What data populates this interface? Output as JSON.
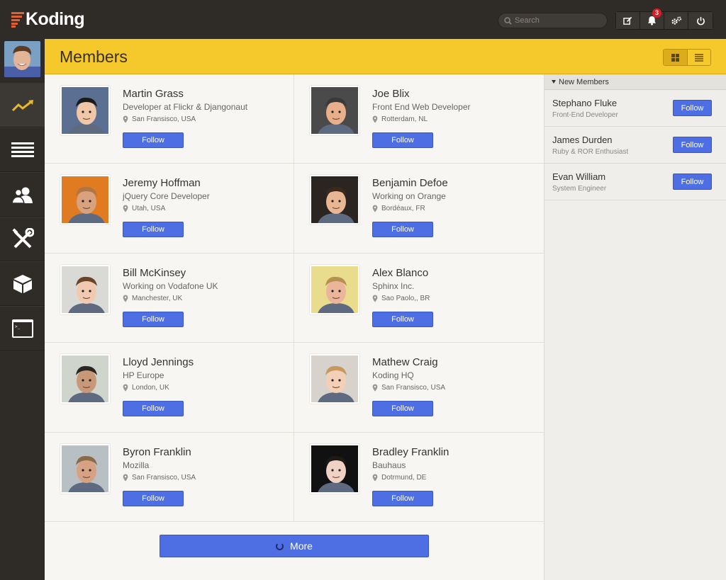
{
  "app": {
    "name": "Koding"
  },
  "search": {
    "placeholder": "Search"
  },
  "notifications": {
    "count": "3"
  },
  "header": {
    "title": "Members"
  },
  "members": [
    {
      "name": "Martin Grass",
      "title": "Developer at Flickr & Djangonaut",
      "location": "San Fransisco, USA",
      "follow": "Follow"
    },
    {
      "name": "Joe Blix",
      "title": "Front End Web Developer",
      "location": "Rotterdam, NL",
      "follow": "Follow"
    },
    {
      "name": "Jeremy Hoffman",
      "title": "jQuery Core Developer",
      "location": "Utah, USA",
      "follow": "Follow"
    },
    {
      "name": "Benjamin Defoe",
      "title": "Working on Orange",
      "location": "Bordéaux, FR",
      "follow": "Follow"
    },
    {
      "name": "Bill McKinsey",
      "title": "Working on Vodafone UK",
      "location": "Manchester, UK",
      "follow": "Follow"
    },
    {
      "name": "Alex Blanco",
      "title": "Sphinx Inc.",
      "location": "Sao Paolo,, BR",
      "follow": "Follow"
    },
    {
      "name": "Lloyd Jennings",
      "title": "HP Europe",
      "location": "London, UK",
      "follow": "Follow"
    },
    {
      "name": "Mathew Craig",
      "title": "Koding HQ",
      "location": "San Fransisco, USA",
      "follow": "Follow"
    },
    {
      "name": "Byron Franklin",
      "title": "Mozilla",
      "location": "San Fransisco, USA",
      "follow": "Follow"
    },
    {
      "name": "Bradley Franklin",
      "title": "Bauhaus",
      "location": "Dotrmund, DE",
      "follow": "Follow"
    }
  ],
  "more": {
    "label": "More"
  },
  "new_members": {
    "heading": "New Members",
    "items": [
      {
        "name": "Stephano Fluke",
        "role": "Front-End Developer",
        "follow": "Follow"
      },
      {
        "name": "James Durden",
        "role": "Ruby & ROR Enthusiast",
        "follow": "Follow"
      },
      {
        "name": "Evan William",
        "role": "System Engineer",
        "follow": "Follow"
      }
    ]
  },
  "colors": {
    "accent": "#f5c82b",
    "button": "#4e6fe3",
    "logo": "#e2602f",
    "activity": "#e8b92c"
  }
}
